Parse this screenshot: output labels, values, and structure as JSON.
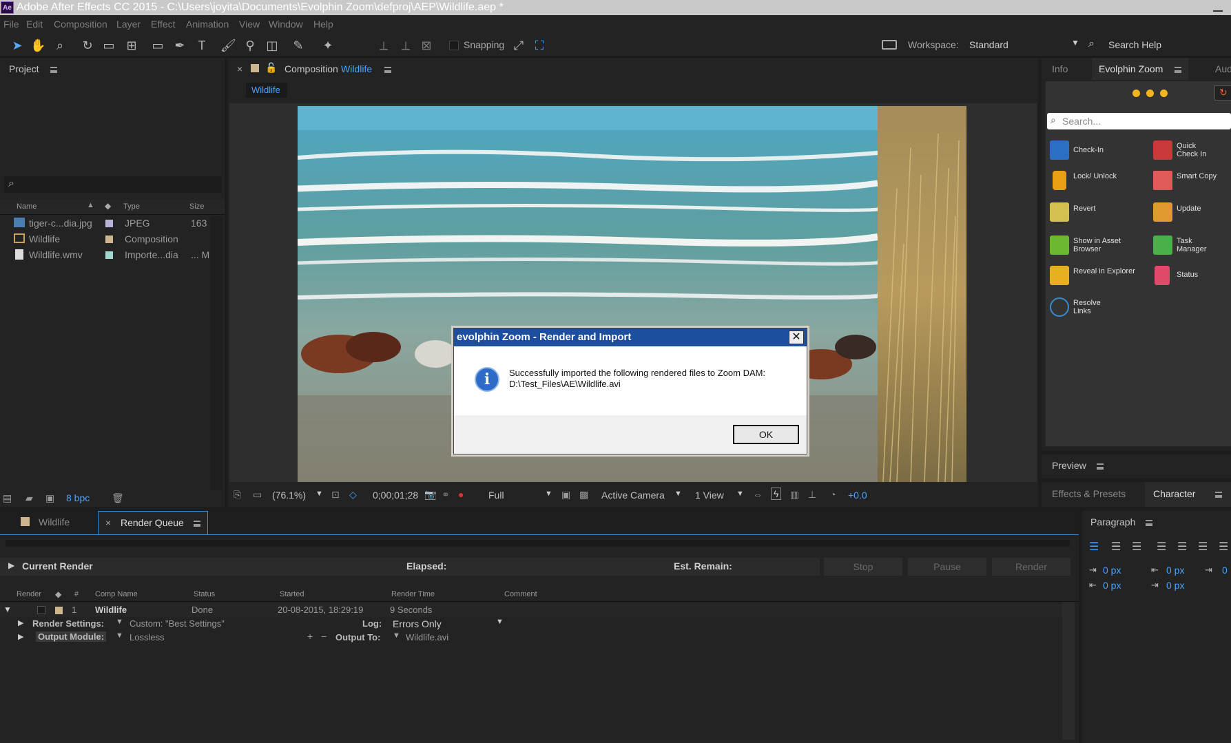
{
  "titlebar": {
    "app_icon": "Ae",
    "title": "Adobe After Effects CC 2015 - C:\\Users\\joyita\\Documents\\Evolphin Zoom\\defproj\\AEP\\Wildlife.aep *"
  },
  "menu": [
    "File",
    "Edit",
    "Composition",
    "Layer",
    "Effect",
    "Animation",
    "View",
    "Window",
    "Help"
  ],
  "toolbar": {
    "snapping_label": "Snapping",
    "workspace_label": "Workspace:",
    "workspace_value": "Standard",
    "search_help": "Search Help"
  },
  "project": {
    "tab": "Project",
    "columns": [
      "Name",
      "Type",
      "Size"
    ],
    "rows": [
      {
        "name": "tiger-c...dia.jpg",
        "type": "JPEG",
        "size": "163",
        "color": "#b6b3d8"
      },
      {
        "name": "Wildlife",
        "type": "Composition",
        "size": "",
        "color": "#cdb58d"
      },
      {
        "name": "Wildlife.wmv",
        "type": "Importe...dia",
        "size": "... M",
        "color": "#9fd8cf"
      }
    ],
    "bpc": "8 bpc"
  },
  "composition": {
    "tab_prefix": "Composition",
    "tab_name": "Wildlife",
    "subtab": "Wildlife",
    "zoom": "(76.1%)",
    "timecode": "0;00;01;28",
    "resolution": "Full",
    "camera": "Active Camera",
    "view": "1 View",
    "exposure": "+0.0"
  },
  "zoom_panel": {
    "tabs": [
      "Info",
      "Evolphin Zoom",
      "Aud"
    ],
    "search_placeholder": "Search...",
    "buttons": [
      {
        "label": "Check-In",
        "icon": "check-in-icon"
      },
      {
        "label": "Quick Check In",
        "icon": "quick-check-in-icon"
      },
      {
        "label": "Lock/ Unlock",
        "icon": "lock-icon"
      },
      {
        "label": "Smart Copy",
        "icon": "smart-copy-icon"
      },
      {
        "label": "Revert",
        "icon": "revert-icon"
      },
      {
        "label": "Update",
        "icon": "update-icon"
      },
      {
        "label": "Show in Asset Browser",
        "icon": "asset-browser-icon"
      },
      {
        "label": "Task Manager",
        "icon": "task-manager-icon"
      },
      {
        "label": "Reveal in Explorer",
        "icon": "folder-icon"
      },
      {
        "label": "Status",
        "icon": "status-icon"
      },
      {
        "label": "Resolve Links",
        "icon": "link-icon"
      }
    ]
  },
  "preview": {
    "tab": "Preview"
  },
  "effects": {
    "tab": "Effects & Presets",
    "tab2": "Character"
  },
  "paragraph": {
    "tab": "Paragraph",
    "v1": "0 px",
    "v2": "0 px",
    "v3": "0",
    "v4": "0 px",
    "v5": "0 px"
  },
  "bottom_tabs": {
    "wildlife": "Wildlife",
    "render_queue": "Render Queue"
  },
  "render_queue": {
    "current_render": "Current Render",
    "elapsed": "Elapsed:",
    "est_remain": "Est. Remain:",
    "stop": "Stop",
    "pause": "Pause",
    "render": "Render",
    "columns": [
      "Render",
      "#",
      "Comp Name",
      "Status",
      "Started",
      "Render Time",
      "Comment"
    ],
    "item": {
      "num": "1",
      "comp": "Wildlife",
      "status": "Done",
      "started": "20-08-2015, 18:29:19",
      "render_time": "9 Seconds"
    },
    "render_settings_label": "Render Settings:",
    "render_settings_value": "Custom: \"Best Settings\"",
    "log_label": "Log:",
    "log_value": "Errors Only",
    "output_module_label": "Output Module:",
    "output_module_value": "Lossless",
    "output_to_label": "Output To:",
    "output_to_value": "Wildlife.avi"
  },
  "dialog": {
    "title": "evolphin Zoom - Render and Import",
    "message_line1": "Successfully imported the following rendered files to Zoom DAM:",
    "message_line2": "D:\\Test_Files\\AE\\Wildlife.avi",
    "ok": "OK",
    "close": "✕"
  }
}
